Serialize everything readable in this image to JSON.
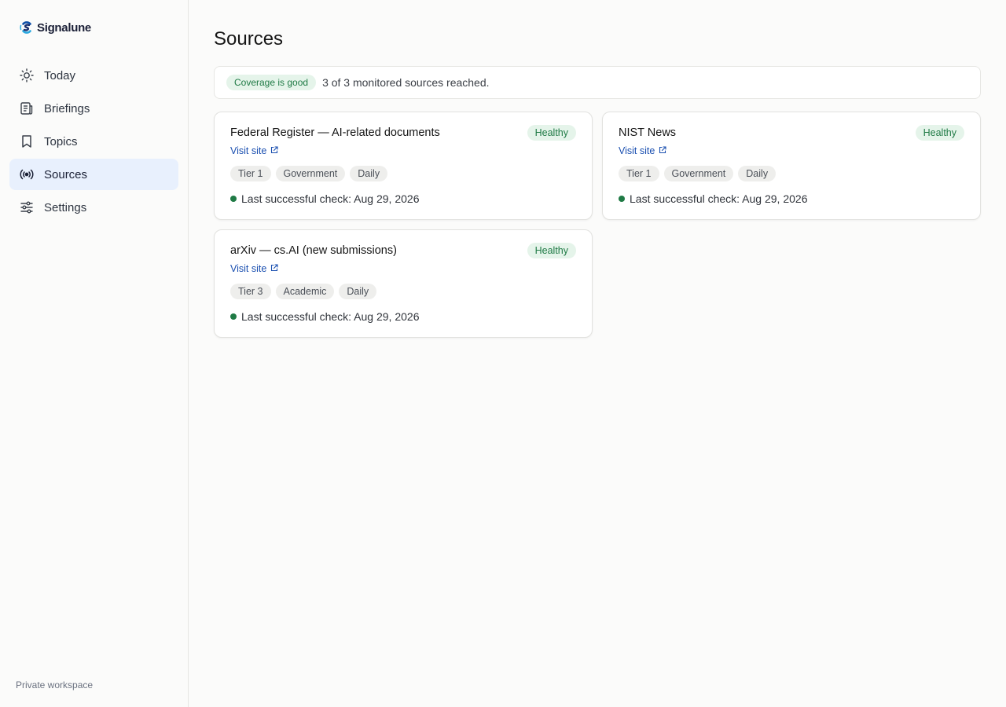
{
  "app": {
    "name": "Signalune",
    "workspace_label": "Private workspace"
  },
  "sidebar": {
    "items": [
      {
        "label": "Today",
        "icon": "sun-icon",
        "active": false
      },
      {
        "label": "Briefings",
        "icon": "newspaper-icon",
        "active": false
      },
      {
        "label": "Topics",
        "icon": "bookmark-icon",
        "active": false
      },
      {
        "label": "Sources",
        "icon": "broadcast-icon",
        "active": true
      },
      {
        "label": "Settings",
        "icon": "sliders-icon",
        "active": false
      }
    ]
  },
  "page": {
    "title": "Sources",
    "coverage": {
      "badge": "Coverage is good",
      "text": "3 of 3 monitored sources reached."
    }
  },
  "sources": [
    {
      "title": "Federal Register — AI-related documents",
      "status": "Healthy",
      "visit_label": "Visit site",
      "tags": [
        "Tier 1",
        "Government",
        "Daily"
      ],
      "last_check": "Last successful check: Aug 29, 2026"
    },
    {
      "title": "NIST News",
      "status": "Healthy",
      "visit_label": "Visit site",
      "tags": [
        "Tier 1",
        "Government",
        "Daily"
      ],
      "last_check": "Last successful check: Aug 29, 2026"
    },
    {
      "title": "arXiv — cs.AI (new submissions)",
      "status": "Healthy",
      "visit_label": "Visit site",
      "tags": [
        "Tier 3",
        "Academic",
        "Daily"
      ],
      "last_check": "Last successful check: Aug 29, 2026"
    }
  ],
  "colors": {
    "accent": "#1a4fb0",
    "healthy": "#1f7a45",
    "healthy_bg": "#e5f4ea",
    "active_nav_bg": "#e8f0fd"
  }
}
